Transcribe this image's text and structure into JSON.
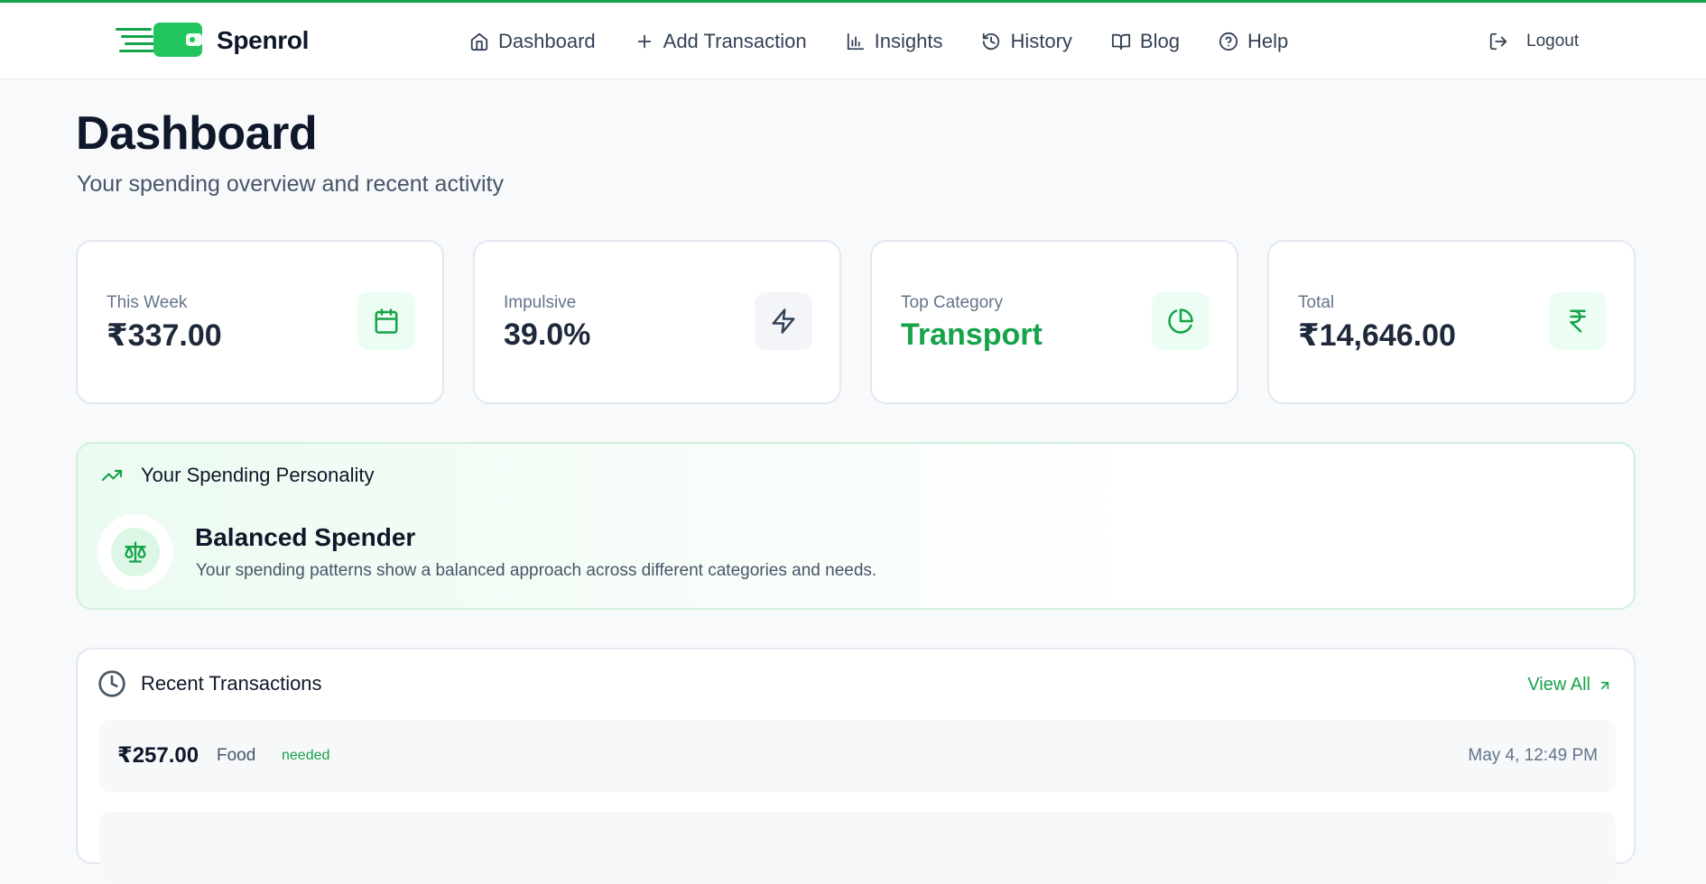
{
  "brand": {
    "name": "Spenrol",
    "color": "#16a34a"
  },
  "nav": {
    "items": [
      {
        "label": "Dashboard",
        "icon": "home-icon"
      },
      {
        "label": "Add Transaction",
        "icon": "plus-icon"
      },
      {
        "label": "Insights",
        "icon": "bar-chart-icon"
      },
      {
        "label": "History",
        "icon": "history-icon"
      },
      {
        "label": "Blog",
        "icon": "book-open-icon"
      },
      {
        "label": "Help",
        "icon": "help-circle-icon"
      }
    ],
    "logout": "Logout"
  },
  "page": {
    "title": "Dashboard",
    "subtitle": "Your spending overview and recent activity"
  },
  "stats": [
    {
      "label": "This Week",
      "value": "₹337.00",
      "icon": "calendar-icon"
    },
    {
      "label": "Impulsive",
      "value": "39.0%",
      "icon": "zap-icon"
    },
    {
      "label": "Top Category",
      "value": "Transport",
      "icon": "pie-chart-icon"
    },
    {
      "label": "Total",
      "value": "₹14,646.00",
      "icon": "rupee-icon"
    }
  ],
  "personality": {
    "heading": "Your Spending Personality",
    "title": "Balanced Spender",
    "description": "Your spending patterns show a balanced approach across different categories and needs.",
    "icon": "scale-icon"
  },
  "recent": {
    "heading": "Recent Transactions",
    "view_all": "View All",
    "transactions": [
      {
        "amount": "₹257.00",
        "category": "Food",
        "tag": "needed",
        "date": "May 4, 12:49 PM"
      }
    ]
  }
}
